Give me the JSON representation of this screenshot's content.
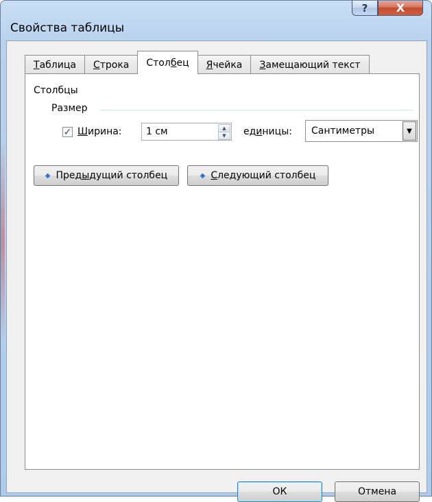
{
  "window": {
    "title": "Свойства таблицы",
    "help_glyph": "?",
    "close_glyph": "X"
  },
  "tabs": [
    {
      "pre": "",
      "ul": "Т",
      "post": "аблица"
    },
    {
      "pre": "",
      "ul": "С",
      "post": "трока"
    },
    {
      "pre": "Стол",
      "ul": "б",
      "post": "ец"
    },
    {
      "pre": "",
      "ul": "Я",
      "post": "чейка"
    },
    {
      "pre": "",
      "ul": "З",
      "post": "амещающий текст"
    }
  ],
  "active_tab_index": 2,
  "columns": {
    "group_label": "Столбцы",
    "size_label": "Размер",
    "width_checked": true,
    "width_label": {
      "ul": "Ш",
      "post": "ирина:"
    },
    "width_value": "1 см",
    "units_label": {
      "pre": "ед",
      "ul": "и",
      "post": "ницы:"
    },
    "units_value": "Сантиметры"
  },
  "buttons": {
    "prev": {
      "pre": "Пред",
      "ul": "ы",
      "post": "дущий столбец"
    },
    "next": {
      "pre": "",
      "ul": "С",
      "post": "ледующий столбец"
    },
    "ok": "ОК",
    "cancel": "Отмена"
  }
}
